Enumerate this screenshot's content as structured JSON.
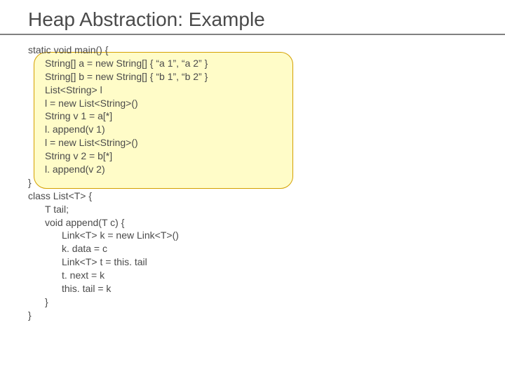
{
  "title": "Heap Abstraction: Example",
  "code": {
    "l0": "static void main() {",
    "l1": "String[] a = new String[] { “a 1”, “a 2” }",
    "l2": "String[] b = new String[] { “b 1”, “b 2” }",
    "l3": "List<String> l",
    "l4": "l = new List<String>()",
    "l5": "String v 1 = a[*]",
    "l6": "l. append(v 1)",
    "l7": "l = new List<String>()",
    "l8": "String v 2 = b[*]",
    "l9": "l. append(v 2)",
    "l10": "}",
    "l11": "class List<T> {",
    "l12": "T tail;",
    "l13": "void append(T c) {",
    "l14": "Link<T> k = new Link<T>()",
    "l15": "k. data = c",
    "l16": "Link<T> t = this. tail",
    "l17": "t. next = k",
    "l18": "this. tail = k",
    "l19": "}",
    "l20": "}"
  }
}
